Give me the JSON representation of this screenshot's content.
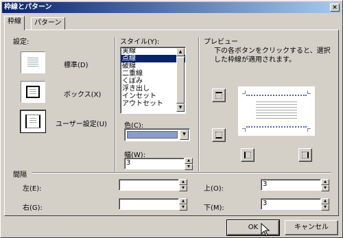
{
  "window": {
    "title": "枠線とパターン",
    "close_glyph": "×"
  },
  "tabs": [
    {
      "label": "枠線"
    },
    {
      "label": "パターン"
    }
  ],
  "settings": {
    "heading": "設定:",
    "presets": [
      {
        "label": "標準(D)",
        "icon": "no-border-icon"
      },
      {
        "label": "ボックス(X)",
        "icon": "box-border-icon"
      },
      {
        "label": "ユーザー設定(U)",
        "icon": "custom-border-icon"
      }
    ]
  },
  "style": {
    "heading": "スタイル(Y):",
    "items": [
      "実線",
      "点線",
      "破線",
      "二重線",
      "くぼみ",
      "浮き出し",
      "インセット",
      "アウトセット"
    ],
    "selected_index": 1,
    "color_label": "色(C):",
    "color_value": "#8a9cc8",
    "width_label": "幅(W):",
    "width_value": "3"
  },
  "preview": {
    "heading": "プレビュー",
    "instruction": "下の各ボタンをクリックすると、選択した枠線が適用されます。",
    "border_color": "#4a5fc8"
  },
  "spacing": {
    "heading": "間隔",
    "left_label": "左(E):",
    "left_value": "",
    "right_label": "右(G):",
    "right_value": "",
    "top_label": "上(O):",
    "top_value": "3",
    "bottom_label": "下(M):",
    "bottom_value": "3"
  },
  "buttons": {
    "ok": "OK",
    "cancel": "キャンセル"
  }
}
